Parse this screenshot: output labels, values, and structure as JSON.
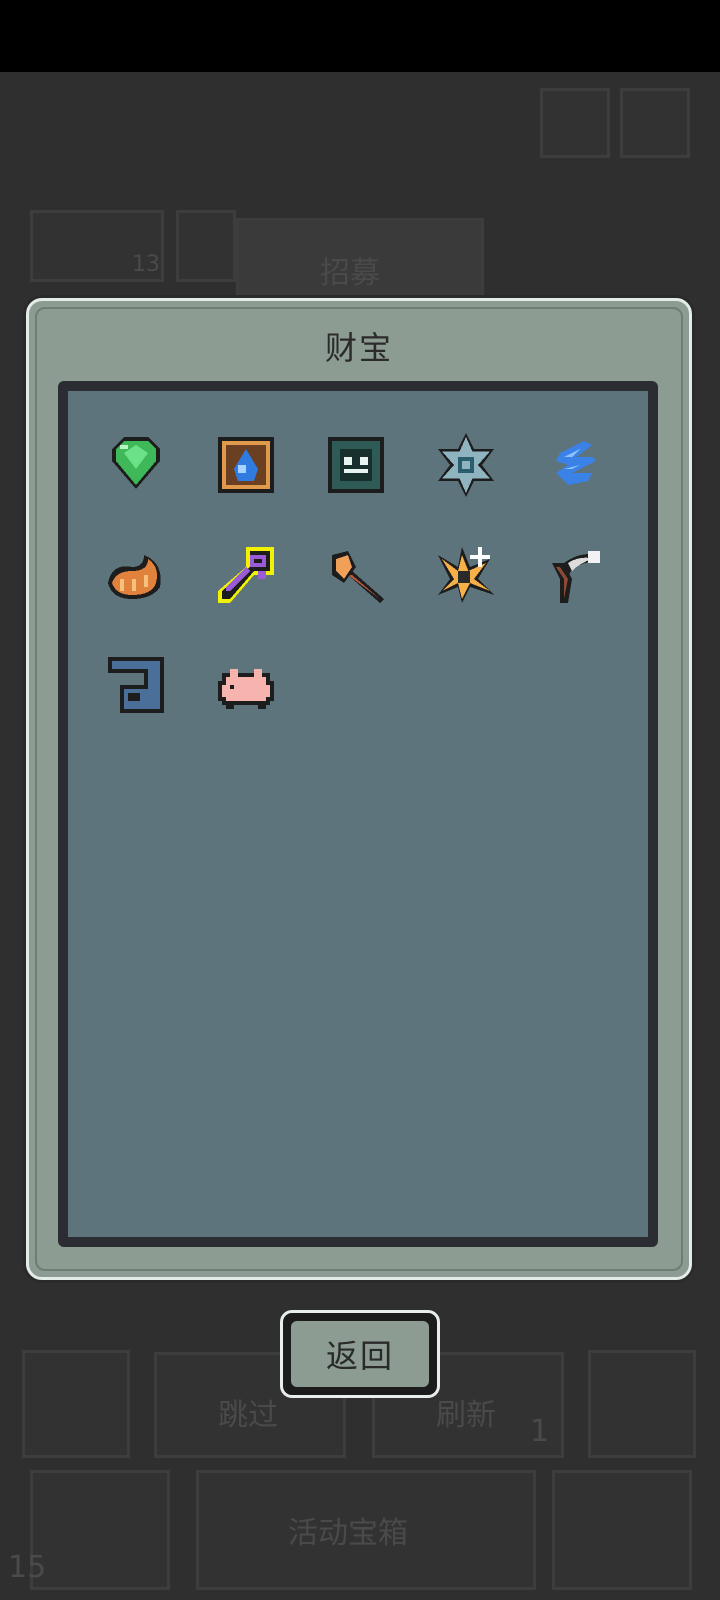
{
  "background": {
    "recruit_tab_label": "招募",
    "skip_label": "跳过",
    "refresh_label": "刷新",
    "refresh_count": "1",
    "level_label": "15",
    "avatar_count": "13",
    "bottom_center_label": "活动宝箱"
  },
  "dialog": {
    "title": "财宝",
    "back_label": "返回"
  },
  "treasures": [
    {
      "name": "green-gem-icon"
    },
    {
      "name": "blue-drop-book-icon"
    },
    {
      "name": "dark-cube-face-icon"
    },
    {
      "name": "gear-sawblade-icon"
    },
    {
      "name": "blue-feather-icon"
    },
    {
      "name": "croissant-icon"
    },
    {
      "name": "purple-key-icon"
    },
    {
      "name": "axe-icon"
    },
    {
      "name": "burst-star-icon"
    },
    {
      "name": "slingshot-icon"
    },
    {
      "name": "pipe-icon"
    },
    {
      "name": "pink-pig-icon"
    }
  ],
  "colors": {
    "dialog_bg": "#8c9c92",
    "panel_bg": "#5d747c",
    "selected_outline": "#f2f200"
  }
}
